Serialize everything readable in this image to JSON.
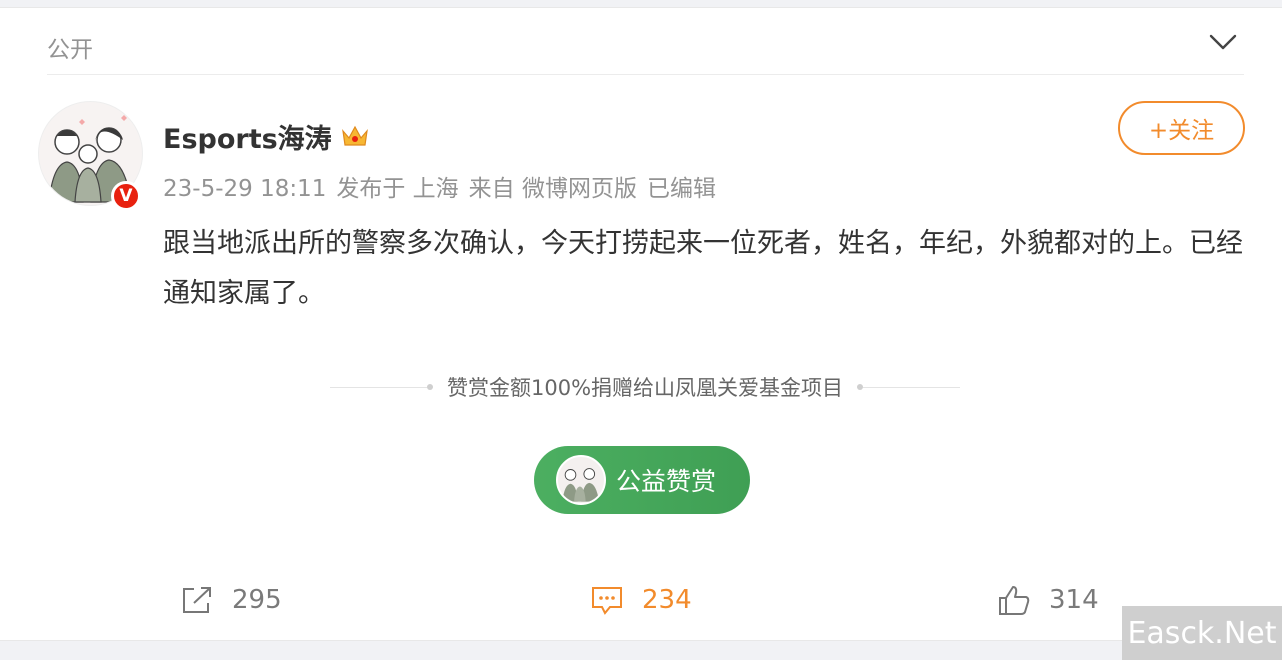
{
  "visibility": {
    "label": "公开"
  },
  "author": {
    "name": "Esports海涛",
    "badge": "V"
  },
  "meta": {
    "time": "23-5-29 18:11",
    "location": "发布于 上海",
    "source": "来自 微博网页版",
    "edited": "已编辑"
  },
  "follow_button": {
    "label": "+关注"
  },
  "post": {
    "text": "跟当地派出所的警察多次确认，今天打捞起来一位死者，姓名，年纪，外貌都对的上。已经通知家属了。"
  },
  "reward": {
    "note": "赞赏金额100%捐赠给山凤凰关爱基金项目",
    "button_label": "公益赞赏"
  },
  "actions": {
    "repost_count": "295",
    "comment_count": "234",
    "like_count": "314"
  },
  "watermark": {
    "text": "Easck.Net"
  },
  "colors": {
    "accent": "#f28b2c",
    "reward_green": "#4caf61",
    "verified_red": "#e8210f"
  }
}
